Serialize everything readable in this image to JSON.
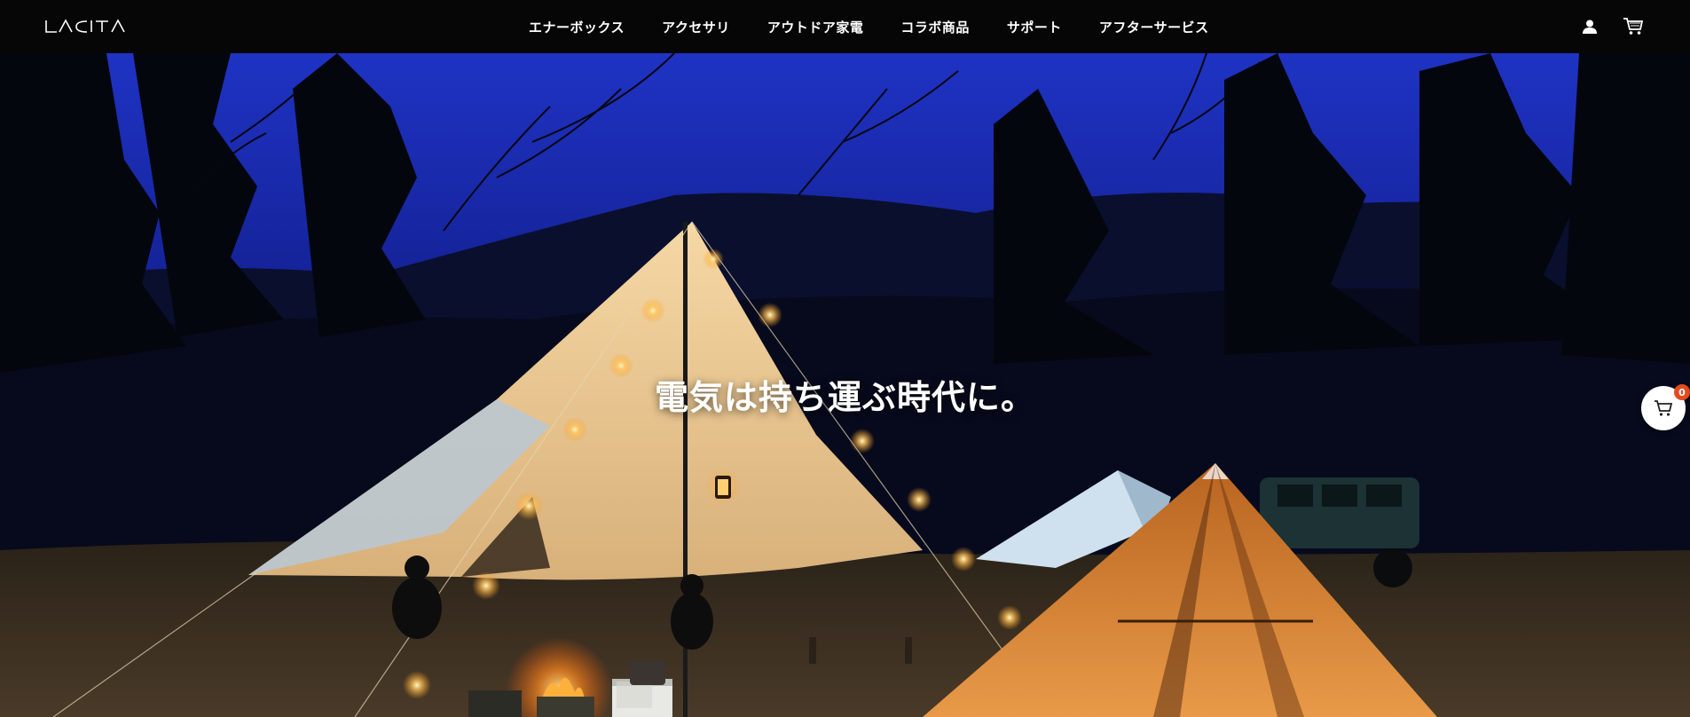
{
  "header": {
    "logo_text": "LACITA",
    "nav": [
      {
        "label": "エナーボックス"
      },
      {
        "label": "アクセサリ"
      },
      {
        "label": "アウトドア家電"
      },
      {
        "label": "コラボ商品"
      },
      {
        "label": "サポート"
      },
      {
        "label": "アフターサービス"
      }
    ],
    "icons": [
      "user-icon",
      "cart-icon"
    ]
  },
  "hero": {
    "headline": "電気は持ち運ぶ時代に。"
  },
  "floating_cart": {
    "icon": "cart-icon",
    "count": "0",
    "badge_color": "#e54a1e"
  },
  "colors": {
    "header_bg": "#060606",
    "sky": "#1c2fa8",
    "tent_glow": "#f0c88a",
    "fire": "#ff9a2e"
  }
}
